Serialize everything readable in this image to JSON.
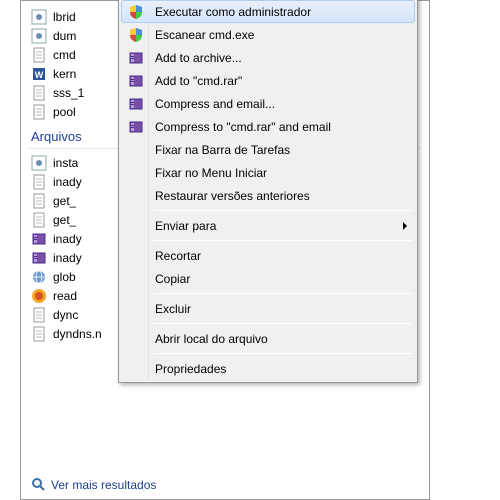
{
  "files_top": [
    {
      "label": "lbrid",
      "icon": "gear"
    },
    {
      "label": "dum",
      "icon": "gear"
    },
    {
      "label": "cmd",
      "icon": "doc"
    },
    {
      "label": "kern",
      "icon": "word"
    },
    {
      "label": "sss_1",
      "icon": "doc"
    },
    {
      "label": "pool",
      "icon": "doc"
    }
  ],
  "section_header": "Arquivos",
  "files_bottom": [
    {
      "label": "insta",
      "icon": "gear"
    },
    {
      "label": "inady",
      "icon": "doc"
    },
    {
      "label": "get_",
      "icon": "doc"
    },
    {
      "label": "get_",
      "icon": "doc"
    },
    {
      "label": "inady",
      "icon": "rar"
    },
    {
      "label": "inady",
      "icon": "rar"
    },
    {
      "label": "glob",
      "icon": "globe"
    },
    {
      "label": "read",
      "icon": "fx"
    },
    {
      "label": "dync",
      "icon": "doc"
    },
    {
      "label": "dyndns.n",
      "icon": "doc"
    }
  ],
  "footer_link": "Ver mais resultados",
  "context_menu": {
    "groups": [
      [
        {
          "label": "Executar como administrador",
          "icon": "shield",
          "highlighted": true
        },
        {
          "label": "Escanear cmd.exe",
          "icon": "shield"
        },
        {
          "label": "Add to archive...",
          "icon": "rar"
        },
        {
          "label": "Add to \"cmd.rar\"",
          "icon": "rar"
        },
        {
          "label": "Compress and email...",
          "icon": "rar"
        },
        {
          "label": "Compress to \"cmd.rar\" and email",
          "icon": "rar"
        },
        {
          "label": "Fixar na Barra de Tarefas",
          "icon": ""
        },
        {
          "label": "Fixar no Menu Iniciar",
          "icon": ""
        },
        {
          "label": "Restaurar versões anteriores",
          "icon": ""
        }
      ],
      [
        {
          "label": "Enviar para",
          "icon": "",
          "submenu": true
        }
      ],
      [
        {
          "label": "Recortar",
          "icon": ""
        },
        {
          "label": "Copiar",
          "icon": ""
        }
      ],
      [
        {
          "label": "Excluir",
          "icon": ""
        }
      ],
      [
        {
          "label": "Abrir local do arquivo",
          "icon": ""
        }
      ],
      [
        {
          "label": "Propriedades",
          "icon": ""
        }
      ]
    ]
  }
}
